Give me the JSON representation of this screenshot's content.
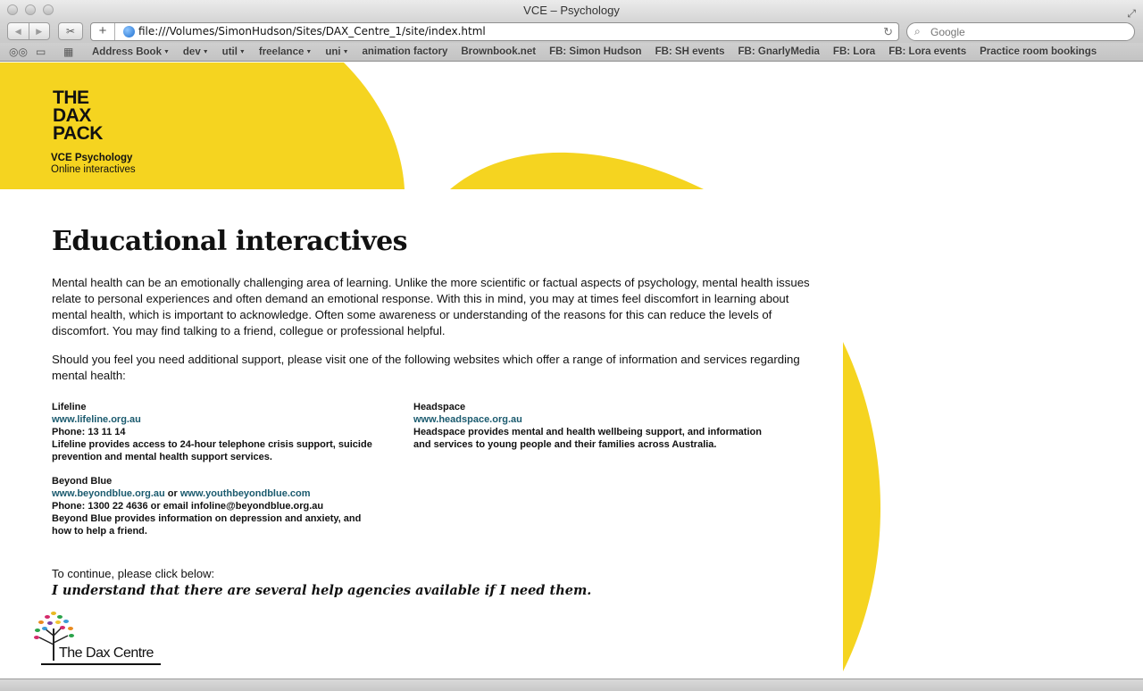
{
  "window": {
    "title": "VCE – Psychology"
  },
  "toolbar": {
    "back": "◀",
    "forward": "▶",
    "add": "+",
    "url": "file:///Volumes/SimonHudson/Sites/DAX_Centre_1/site/index.html",
    "search_placeholder": "Google"
  },
  "bookmarks": [
    {
      "label": "Address Book",
      "menu": true
    },
    {
      "label": "dev",
      "menu": true
    },
    {
      "label": "util",
      "menu": true
    },
    {
      "label": "freelance",
      "menu": true
    },
    {
      "label": "uni",
      "menu": true
    },
    {
      "label": "animation factory",
      "menu": false
    },
    {
      "label": "Brownbook.net",
      "menu": false
    },
    {
      "label": "FB: Simon Hudson",
      "menu": false
    },
    {
      "label": "FB: SH events",
      "menu": false
    },
    {
      "label": "FB: GnarlyMedia",
      "menu": false
    },
    {
      "label": "FB: Lora",
      "menu": false
    },
    {
      "label": "FB: Lora events",
      "menu": false
    },
    {
      "label": "Practice room bookings",
      "menu": false
    }
  ],
  "brand": {
    "line1": "THE",
    "line2": "DAX",
    "line3": "PACK",
    "course": "VCE Psychology",
    "tagline": "Online interactives",
    "accent_color": "#f5d420"
  },
  "main": {
    "heading": "Educational interactives",
    "para1": "Mental health can be an emotionally challenging area of learning. Unlike the more scientific or factual aspects of psychology, mental health issues relate to personal experiences and often demand an emotional response. With this in mind, you may at times feel discomfort in learning about mental health, which is important to acknowledge. Often some awareness or understanding of the reasons for this can reduce the levels of discomfort. You may find talking to a friend, collegue or professional helpful.",
    "para2": "Should you feel you need additional support, please visit one of the following websites which offer a range of information and services regarding mental health:",
    "orgs": {
      "lifeline": {
        "name": "Lifeline",
        "link": "www.lifeline.org.au",
        "phone": "Phone: 13 11 14",
        "desc": "Lifeline provides access to 24-hour telephone crisis support, suicide prevention and mental health support services."
      },
      "headspace": {
        "name": "Headspace",
        "link": "www.headspace.org.au",
        "desc": "Headspace provides mental and health wellbeing support, and information and services to young people and their families across Australia."
      },
      "beyondblue": {
        "name": "Beyond Blue",
        "link1": "www.beyondblue.org.au",
        "or": "or",
        "link2": "www.youthbeyondblue.com",
        "phone": "Phone: 1300 22 4636 or email infoline@beyondblue.org.au",
        "desc": "Beyond Blue provides information on depression and anxiety, and how to help a friend."
      }
    },
    "continue_prompt": "To continue, please click below:",
    "understand_link": "I understand that there are several help agencies available if I need them."
  },
  "footer": {
    "logo_text": "The Dax Centre"
  }
}
